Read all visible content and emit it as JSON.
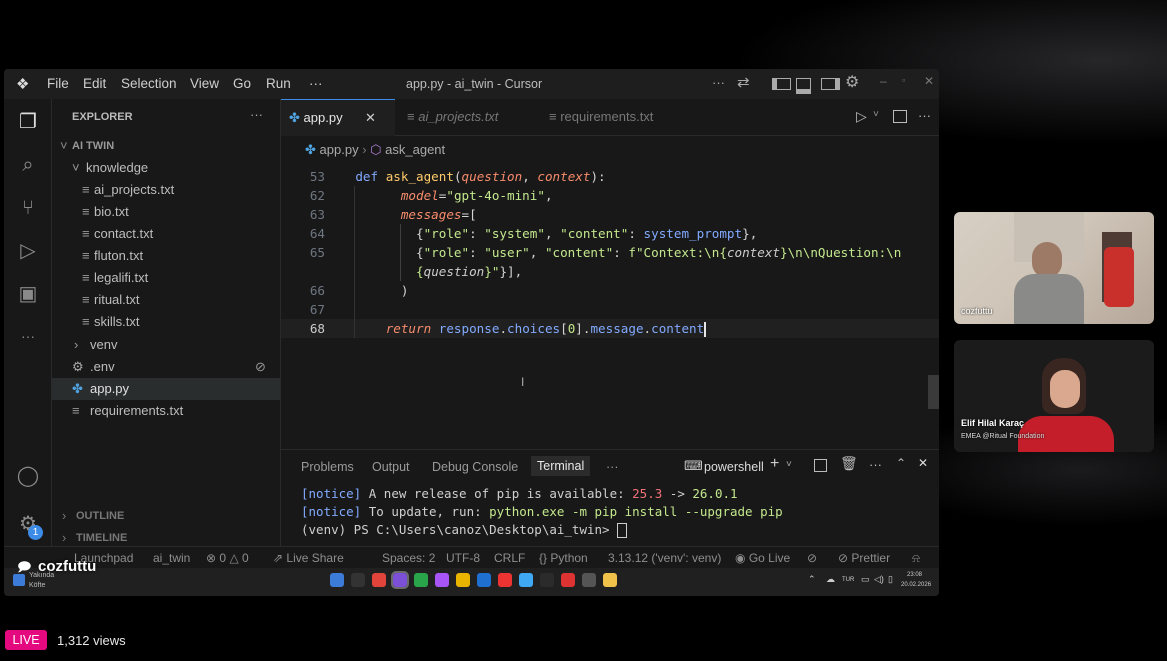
{
  "window": {
    "title": "app.py - ai_twin - Cursor",
    "menu": [
      "File",
      "Edit",
      "Selection",
      "View",
      "Go",
      "Run",
      "···"
    ]
  },
  "explorer": {
    "heading": "EXPLORER",
    "more": "···",
    "project": "AI TWIN",
    "folder": "knowledge",
    "files": [
      "ai_projects.txt",
      "bio.txt",
      "contact.txt",
      "fluton.txt",
      "legalifi.txt",
      "ritual.txt",
      "skills.txt"
    ],
    "venv": "venv",
    "env": ".env",
    "app": "app.py",
    "requirements": "requirements.txt",
    "outline": "OUTLINE",
    "timeline": "TIMELINE",
    "badge": "1"
  },
  "tabs": [
    {
      "label": "app.py",
      "active": true
    },
    {
      "label": "ai_projects.txt",
      "active": false
    },
    {
      "label": "requirements.txt",
      "active": false
    }
  ],
  "breadcrumb": {
    "file": "app.py",
    "symbol": "ask_agent"
  },
  "code": [
    {
      "ln": "53",
      "tokens": [
        [
          "kw",
          "def "
        ],
        [
          "fn",
          "ask_agent"
        ],
        [
          "",
          "("
        ],
        [
          "par",
          "question"
        ],
        [
          "",
          ", "
        ],
        [
          "par",
          "context"
        ],
        [
          "",
          "):"
        ]
      ]
    },
    {
      "ln": "62",
      "tokens": [
        [
          "",
          "      "
        ],
        [
          "par",
          "model"
        ],
        [
          "",
          "="
        ],
        [
          "str",
          "\"gpt-4o-mini\""
        ],
        [
          "",
          ","
        ]
      ]
    },
    {
      "ln": "63",
      "tokens": [
        [
          "",
          "      "
        ],
        [
          "par",
          "messages"
        ],
        [
          "",
          "=["
        ]
      ]
    },
    {
      "ln": "64",
      "tokens": [
        [
          "",
          "        {"
        ],
        [
          "str",
          "\"role\""
        ],
        [
          "",
          ": "
        ],
        [
          "str",
          "\"system\""
        ],
        [
          "",
          ", "
        ],
        [
          "str",
          "\"content\""
        ],
        [
          "",
          ": "
        ],
        [
          "kw",
          "system_prompt"
        ],
        [
          "",
          "},"
        ]
      ]
    },
    {
      "ln": "65",
      "tokens": [
        [
          "",
          "        {"
        ],
        [
          "str",
          "\"role\""
        ],
        [
          "",
          ": "
        ],
        [
          "str",
          "\"user\""
        ],
        [
          "",
          ", "
        ],
        [
          "str",
          "\"content\""
        ],
        [
          "",
          ": "
        ],
        [
          "str",
          "f\"Context:\\n{"
        ],
        [
          "it",
          "context"
        ],
        [
          "str",
          "}\\n\\nQuestion:\\n"
        ]
      ]
    },
    {
      "ln": "",
      "tokens": [
        [
          "",
          "        "
        ],
        [
          "str",
          "{"
        ],
        [
          "it",
          "question"
        ],
        [
          "str",
          "}\""
        ],
        [
          "",
          "}],"
        ]
      ]
    },
    {
      "ln": "66",
      "tokens": [
        [
          "",
          "      )"
        ]
      ]
    },
    {
      "ln": "67",
      "tokens": [
        [
          "",
          ""
        ]
      ]
    },
    {
      "ln": "68",
      "tokens": [
        [
          "",
          "    "
        ],
        [
          "par",
          "return "
        ],
        [
          "kw",
          "response"
        ],
        [
          "",
          "."
        ],
        [
          "kw",
          "choices"
        ],
        [
          "",
          "["
        ],
        [
          "str",
          "0"
        ],
        [
          "",
          "]."
        ],
        [
          "kw",
          "message"
        ],
        [
          "",
          "."
        ],
        [
          "kw",
          "content"
        ]
      ]
    }
  ],
  "panel": {
    "tabs": [
      "Problems",
      "Output",
      "Debug Console",
      "Terminal",
      "···"
    ],
    "active_tab": "Terminal",
    "shell": "powershell",
    "lines": [
      {
        "tag": "[notice]",
        "text": " A new release of pip is available: ",
        "old": "25.3",
        "arrow": " -> ",
        "new": "26.0.1"
      },
      {
        "tag": "[notice]",
        "text": " To update, run: ",
        "cmd": "python.exe -m pip install --upgrade pip"
      },
      {
        "prompt": "(venv) PS C:\\Users\\canoz\\Desktop\\ai_twin> "
      }
    ]
  },
  "status": {
    "launchpad": "Launchpad",
    "project": "ai_twin",
    "errors": "0",
    "warnings": "0",
    "liveshare": "Live Share",
    "spaces": "Spaces: 2",
    "encoding": "UTF-8",
    "eol": "CRLF",
    "language": "Python",
    "interpreter": "3.13.12 ('venv': venv)",
    "golive": "Go Live",
    "prettier": "Prettier"
  },
  "taskbar": {
    "weather_line1": "Yakında",
    "weather_line2": "Köfte",
    "lang": "TUR",
    "time": "23:08",
    "date": "20.02.2026",
    "app_colors": [
      "#3d7bd8",
      "#333333",
      "#e0443a",
      "#7b4fd6",
      "#2aa44a",
      "#a855f7",
      "#e8b400",
      "#1f6fd1",
      "#e33",
      "#3fa9f5",
      "#2b2b2b",
      "#d33",
      "#555",
      "#f0c24a"
    ]
  },
  "overlay": {
    "streamer": "cozfuttu",
    "live": "LIVE",
    "views": "1,312 views"
  },
  "cams": [
    {
      "label": "cozfuttu"
    },
    {
      "name": "Elif Hilal Karaç",
      "title": "EMEA @Ritual Foundation"
    }
  ]
}
